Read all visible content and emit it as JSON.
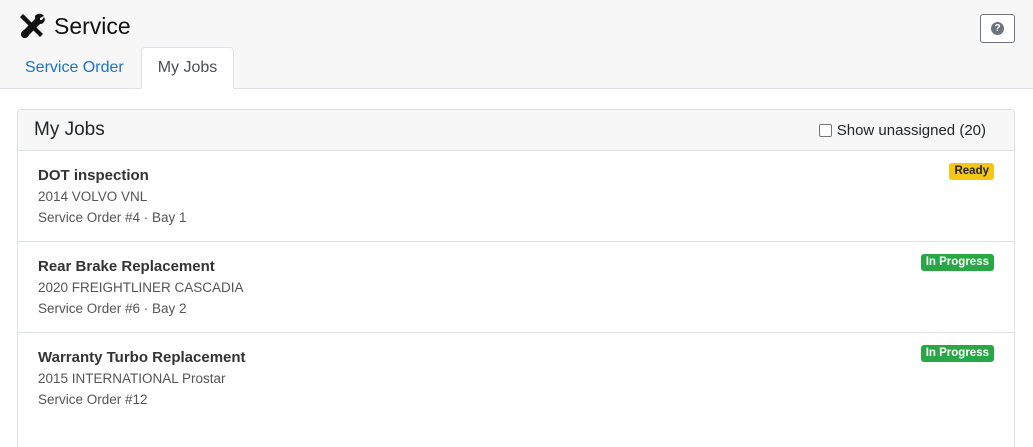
{
  "app": {
    "title": "Service",
    "logo_icon": "wrench-screwdriver-icon",
    "help_icon": "question-circle-icon"
  },
  "tabs": [
    {
      "label": "Service Order",
      "active": false
    },
    {
      "label": "My Jobs",
      "active": true
    }
  ],
  "panel": {
    "title": "My Jobs",
    "show_unassigned_label": "Show unassigned (20)",
    "show_unassigned_checked": false
  },
  "jobs": [
    {
      "title": "DOT inspection",
      "vehicle": "2014 VOLVO VNL",
      "location": "Service Order #4 · Bay 1",
      "status": "Ready",
      "status_color": "#f5c518"
    },
    {
      "title": "Rear Brake Replacement",
      "vehicle": "2020 FREIGHTLINER CASCADIA",
      "location": "Service Order #6 · Bay 2",
      "status": "In Progress",
      "status_color": "#28a745"
    },
    {
      "title": "Warranty Turbo Replacement",
      "vehicle": "2015 INTERNATIONAL Prostar",
      "location": "Service Order #12",
      "status": "In Progress",
      "status_color": "#28a745"
    }
  ]
}
